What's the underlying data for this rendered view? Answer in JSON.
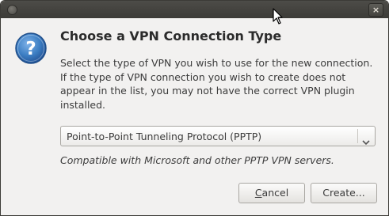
{
  "titlebar": {
    "close_label": "×",
    "icons": [
      "window-menu-icon",
      "close-icon"
    ]
  },
  "dialog": {
    "icon": "question-icon",
    "heading": "Choose a VPN Connection Type",
    "description": "Select the type of VPN you wish to use for the new connection.  If the type of VPN connection you wish to create does not appear in the list, you may not have the correct VPN plugin installed.",
    "vpn_type": {
      "selected": "Point-to-Point Tunneling Protocol (PPTP)"
    },
    "compat_note": "Compatible with Microsoft and other PPTP VPN servers."
  },
  "buttons": {
    "cancel_mnemonic": "C",
    "cancel_rest": "ancel",
    "create_label": "Create..."
  },
  "colors": {
    "titlebar": "#3c3b37",
    "window_bg": "#f2f1f0",
    "question_icon": "#3d7fc4"
  }
}
